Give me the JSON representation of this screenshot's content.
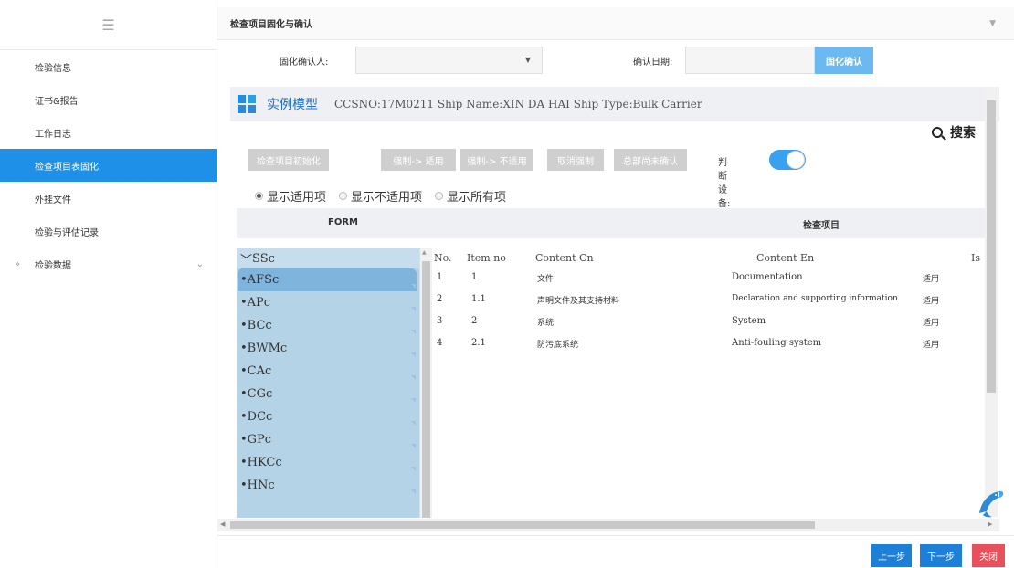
{
  "sidebar": {
    "items": [
      {
        "label": "检验信息"
      },
      {
        "label": "证书&报告"
      },
      {
        "label": "工作日志"
      },
      {
        "label": "检查项目表固化"
      },
      {
        "label": "外挂文件"
      },
      {
        "label": "检验与评估记录"
      },
      {
        "label": "检验数据"
      }
    ],
    "active_index": 3,
    "expand_prefix": "»",
    "expand_chevron": "⌄"
  },
  "header": {
    "title": "检查项目固化与确认"
  },
  "confirm": {
    "person_label": "固化确认人:",
    "person_value": "",
    "date_label": "确认日期:",
    "date_value": "",
    "button_label": "固化确认"
  },
  "panel": {
    "title": "实例模型",
    "meta": "CCSNO:17M0211  Ship Name:XIN DA HAI  Ship Type:Bulk Carrier",
    "search_label": "搜索"
  },
  "actions": {
    "buttons": [
      "检查项目初始化",
      "强制-> 适用",
      "强制-> 不适用",
      "取消强制",
      "总部尚未确认"
    ],
    "judge_label": "判断设备:",
    "judge_on": true
  },
  "filters": {
    "options": [
      "显示适用项",
      "显示不适用项",
      "显示所有项"
    ],
    "selected_index": 0
  },
  "columns": {
    "form": "FORM",
    "items": "检查项目"
  },
  "tree": {
    "root": "SSc",
    "nodes": [
      "AFSc",
      "APc",
      "BCc",
      "BWMc",
      "CAc",
      "CGc",
      "DCc",
      "GPc",
      "HKCc",
      "HNc"
    ],
    "selected_index": 0
  },
  "table": {
    "headers": [
      "No.",
      "Item no",
      "Content Cn",
      "Content En",
      "Isvis"
    ],
    "rows": [
      {
        "no": "1",
        "item_no": "1",
        "cn": "文件",
        "en": "Documentation",
        "isvis": "适用"
      },
      {
        "no": "2",
        "item_no": "1.1",
        "cn": "声明文件及其支持材料",
        "en": "Declaration and supporting information",
        "isvis": "适用"
      },
      {
        "no": "3",
        "item_no": "2",
        "cn": "系统",
        "en": "System",
        "isvis": "适用"
      },
      {
        "no": "4",
        "item_no": "2.1",
        "cn": "防污底系统",
        "en": "Anti-fouling system",
        "isvis": "适用"
      }
    ]
  },
  "footer": {
    "prev": "上一步",
    "next": "下一步",
    "close": "关闭"
  },
  "colors": {
    "accent": "#1e90e8",
    "close": "#e8505b",
    "tree": "#b5d3e6"
  }
}
